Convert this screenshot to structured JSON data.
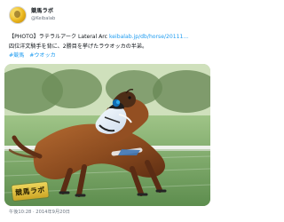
{
  "account": {
    "display_name": "競馬ラボ",
    "handle": "@Keibalab"
  },
  "tweet": {
    "line1_prefix": "【PHOTO】ラテラルアーク Lateral Arc",
    "line1_link": "keibalab.jp/db/horse/20111...",
    "line2": "四位洋文騎手を背に、2勝目を挙げたラウオッカの半弟。",
    "hashtags": [
      "#競馬",
      "#ウオッカ"
    ],
    "timestamp": "午後10:28 · 2014年9月20日"
  },
  "media": {
    "watermark_text": "競馬ラボ",
    "colors": {
      "grass": "#7fa86d",
      "trees": "#3f5a2e",
      "horse": "#8c4a1f",
      "silks": "#d9e6f2",
      "accent": "#1d9bf0"
    }
  }
}
